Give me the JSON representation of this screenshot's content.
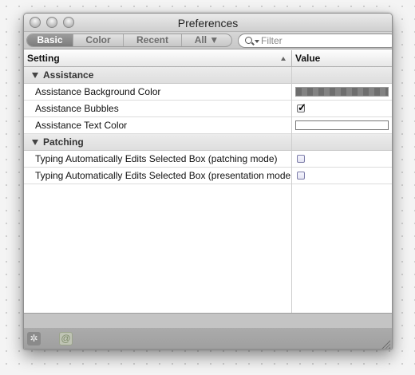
{
  "window": {
    "title": "Preferences"
  },
  "tabs": [
    {
      "label": "Basic",
      "active": true
    },
    {
      "label": "Color",
      "active": false
    },
    {
      "label": "Recent",
      "active": false
    },
    {
      "label": "All ▼",
      "active": false
    }
  ],
  "search": {
    "placeholder": "Filter",
    "value": ""
  },
  "table": {
    "columns": {
      "setting": "Setting",
      "value": "Value"
    },
    "groups": [
      {
        "label": "Assistance",
        "rows": [
          {
            "setting": "Assistance Background Color",
            "value_type": "color",
            "color": "#787878"
          },
          {
            "setting": "Assistance Bubbles",
            "value_type": "checkbox",
            "checked": true
          },
          {
            "setting": "Assistance Text Color",
            "value_type": "color",
            "color": "#ffffff"
          }
        ]
      },
      {
        "label": "Patching",
        "rows": [
          {
            "setting": "Typing Automatically Edits Selected Box (patching mode)",
            "value_type": "checkbox",
            "checked": false
          },
          {
            "setting": "Typing Automatically Edits Selected Box (presentation mode)",
            "value_type": "checkbox",
            "checked": false
          }
        ]
      }
    ]
  },
  "footer": {
    "gear_glyph": "✲",
    "at_glyph": "@"
  },
  "icons": {
    "checkmark": "✓"
  }
}
